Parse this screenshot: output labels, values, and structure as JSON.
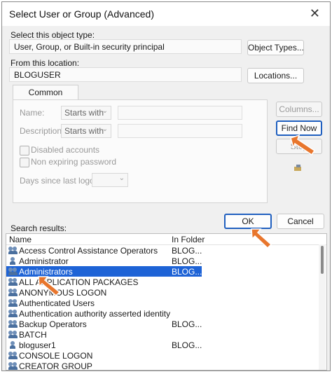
{
  "window": {
    "title": "Select User or Group (Advanced)",
    "close_glyph": "✕"
  },
  "object_type": {
    "label": "Select this object type:",
    "value": "User, Group, or Built-in security principal",
    "button": "Object Types..."
  },
  "location": {
    "label": "From this location:",
    "value": "BLOGUSER",
    "button": "Locations..."
  },
  "queries": {
    "tab": "Common Queries",
    "name_label": "Name:",
    "name_mode": "Starts with",
    "description_label": "Description:",
    "description_mode": "Starts with",
    "disabled_accounts": "Disabled accounts",
    "non_expiring_password": "Non expiring password",
    "days_label": "Days since last logon:",
    "columns_button": "Columns...",
    "find_now_button": "Find Now",
    "stop_button": "Stop"
  },
  "actions": {
    "ok": "OK",
    "cancel": "Cancel"
  },
  "results": {
    "label": "Search results:",
    "columns": [
      "Name",
      "In Folder"
    ],
    "rows": [
      {
        "name": "Access Control Assistance Operators",
        "folder": "BLOG..."
      },
      {
        "name": "Administrator",
        "folder": "BLOG..."
      },
      {
        "name": "Administrators",
        "folder": "BLOG...",
        "selected": true
      },
      {
        "name": "ALL APPLICATION PACKAGES",
        "folder": ""
      },
      {
        "name": "ANONYMOUS LOGON",
        "folder": ""
      },
      {
        "name": "Authenticated Users",
        "folder": ""
      },
      {
        "name": "Authentication authority asserted identity",
        "folder": ""
      },
      {
        "name": "Backup Operators",
        "folder": "BLOG..."
      },
      {
        "name": "BATCH",
        "folder": ""
      },
      {
        "name": "bloguser1",
        "folder": "BLOG..."
      },
      {
        "name": "CONSOLE LOGON",
        "folder": ""
      },
      {
        "name": "CREATOR GROUP",
        "folder": ""
      }
    ]
  },
  "colors": {
    "accent": "#1e63d6",
    "arrow": "#e8762d"
  }
}
